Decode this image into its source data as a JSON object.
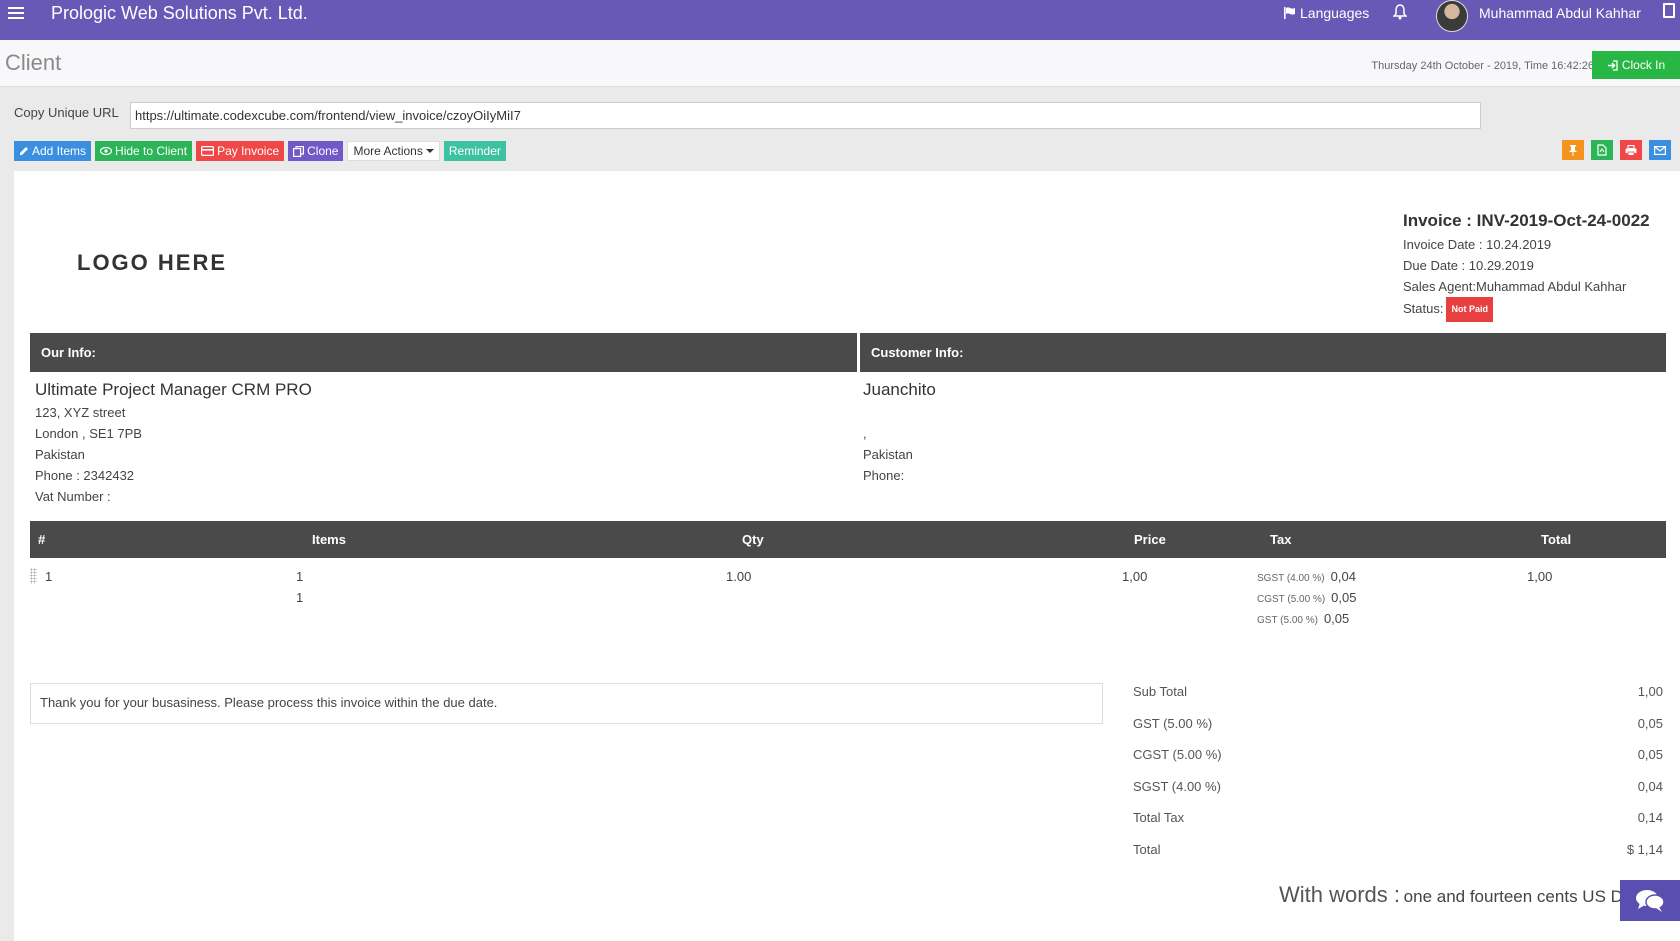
{
  "topbar": {
    "brand": "Prologic Web Solutions Pvt. Ltd.",
    "languages_label": "Languages",
    "user_name": "Muhammad Abdul Kahhar"
  },
  "header": {
    "title": "Client",
    "datetime": "Thursday 24th October - 2019,  Time  16:42:26",
    "clock_in_label": "Clock In"
  },
  "url_row": {
    "label": "Copy Unique URL",
    "value": "https://ultimate.codexcube.com/frontend/view_invoice/czoyOiIyMiI7"
  },
  "actions": {
    "add_items": "Add Items",
    "hide_to_client": "Hide to Client",
    "pay_invoice": "Pay Invoice",
    "clone": "Clone",
    "more_actions": "More Actions",
    "reminder": "Reminder"
  },
  "invoice": {
    "logo_text": "LOGO HERE",
    "number": "Invoice : INV-2019-Oct-24-0022",
    "date": "Invoice Date : 10.24.2019",
    "due_date": "Due Date : 10.29.2019",
    "sales_agent": "Sales Agent:Muhammad Abdul Kahhar",
    "status_label": "Status:",
    "status_value": "Not Paid"
  },
  "our_info": {
    "heading": "Our Info:",
    "name": "Ultimate Project Manager CRM PRO",
    "lines": [
      "123, XYZ street",
      "London , SE1 7PB",
      "Pakistan",
      "Phone : 2342432",
      "Vat Number :"
    ]
  },
  "customer_info": {
    "heading": "Customer Info:",
    "name": "Juanchito",
    "lines": [
      "",
      ",",
      "Pakistan",
      "Phone:"
    ]
  },
  "items_table": {
    "headers": [
      "#",
      "Items",
      "Qty",
      "Price",
      "Tax",
      "Total"
    ],
    "rows": [
      {
        "num": "1",
        "item": "1",
        "item_desc": "1",
        "qty": "1.00",
        "price": "1,00",
        "taxes": [
          {
            "label": "SGST (4.00 %)",
            "value": "0,04"
          },
          {
            "label": "CGST (5.00 %)",
            "value": "0,05"
          },
          {
            "label": "GST (5.00 %)",
            "value": "0,05"
          }
        ],
        "total": "1,00"
      }
    ]
  },
  "terms": "Thank you for your busasiness. Please process this invoice within the due date.",
  "totals": [
    {
      "label": "Sub Total",
      "value": "1,00"
    },
    {
      "label": "GST (5.00 %)",
      "value": "0,05"
    },
    {
      "label": "CGST (5.00 %)",
      "value": "0,05"
    },
    {
      "label": "SGST (4.00 %)",
      "value": "0,04"
    },
    {
      "label": "Total Tax",
      "value": "0,14"
    },
    {
      "label": "Total",
      "value": "$ 1,14"
    }
  ],
  "words": {
    "label": "With words :",
    "value": "one and fourteen cents US D"
  },
  "colors": {
    "topbar": "#6959b7",
    "clock_in": "#28b744",
    "status_not_paid": "#e84040",
    "table_header": "#4a4a4a"
  },
  "icons": [
    "menu-icon",
    "flag-icon",
    "bell-icon",
    "exit-icon",
    "sign-in-icon",
    "pencil-icon",
    "eye-icon",
    "credit-card-icon",
    "copy-icon",
    "pin-icon",
    "pdf-icon",
    "print-icon",
    "email-icon",
    "chat-icon"
  ]
}
